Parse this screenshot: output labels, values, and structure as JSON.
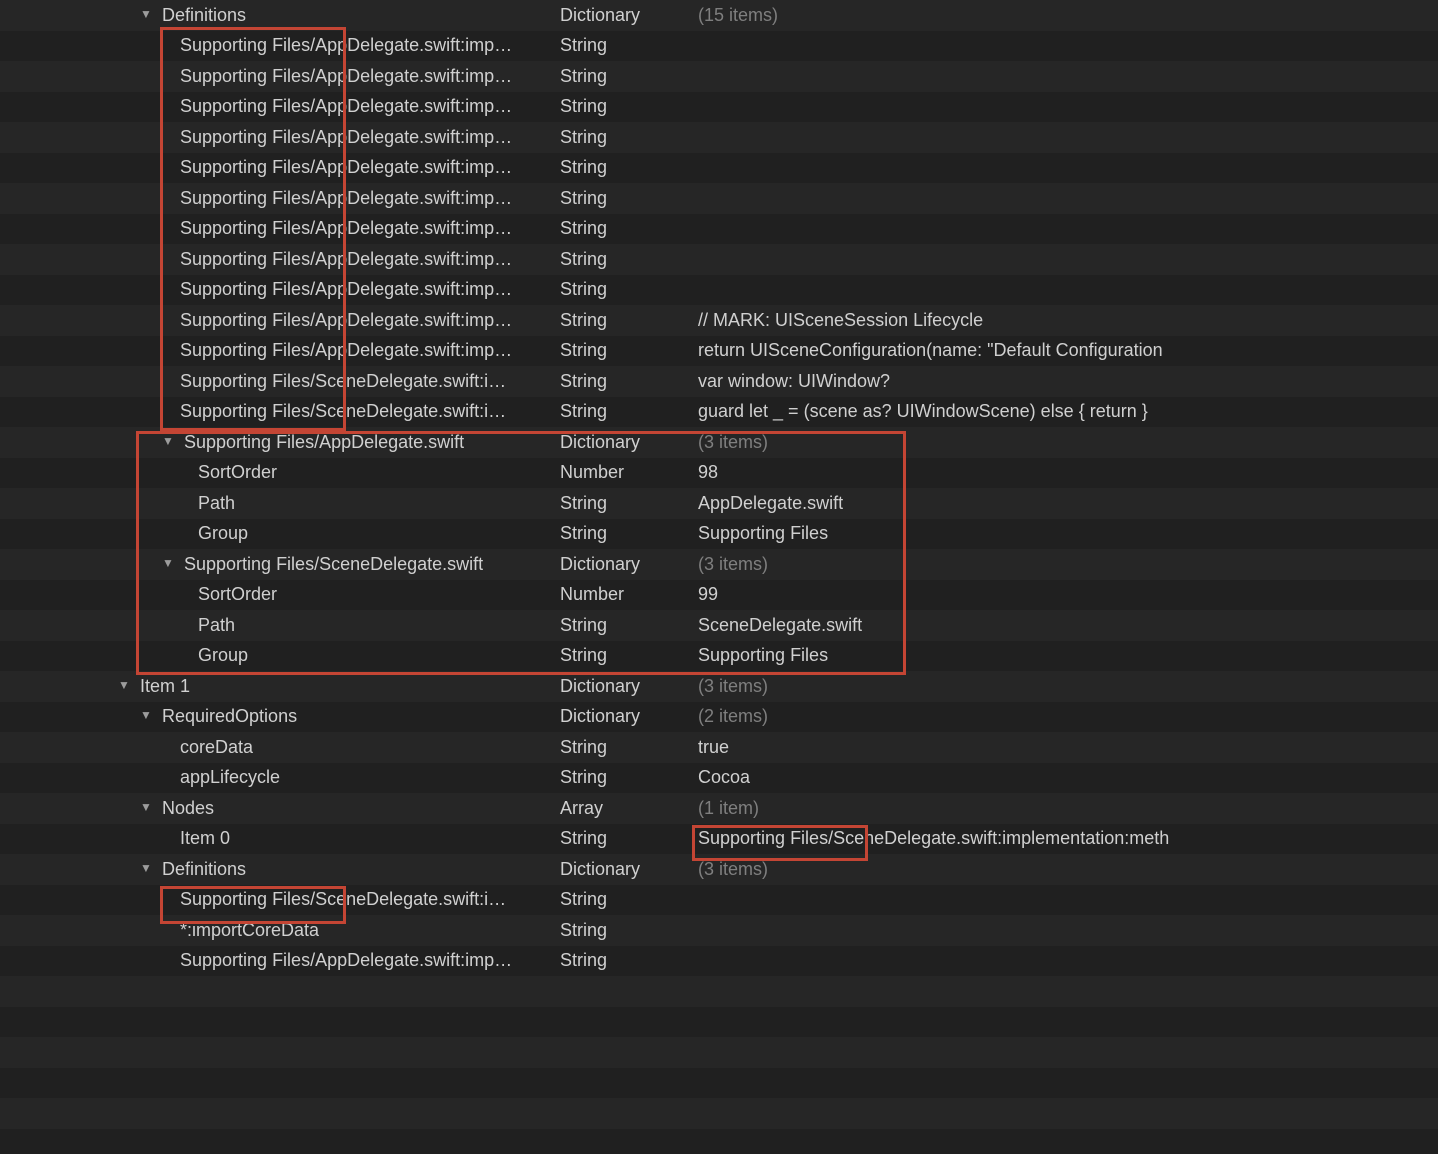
{
  "rows": [
    {
      "indent": 1,
      "expand": true,
      "key": "Definitions",
      "type": "Dictionary",
      "value": "(15 items)",
      "dim": true
    },
    {
      "indent": 3,
      "expand": false,
      "key": "Supporting Files/AppDelegate.swift:imp…",
      "type": "String",
      "value": ""
    },
    {
      "indent": 3,
      "expand": false,
      "key": "Supporting Files/AppDelegate.swift:imp…",
      "type": "String",
      "value": ""
    },
    {
      "indent": 3,
      "expand": false,
      "key": "Supporting Files/AppDelegate.swift:imp…",
      "type": "String",
      "value": ""
    },
    {
      "indent": 3,
      "expand": false,
      "key": "Supporting Files/AppDelegate.swift:imp…",
      "type": "String",
      "value": ""
    },
    {
      "indent": 3,
      "expand": false,
      "key": "Supporting Files/AppDelegate.swift:imp…",
      "type": "String",
      "value": ""
    },
    {
      "indent": 3,
      "expand": false,
      "key": "Supporting Files/AppDelegate.swift:imp…",
      "type": "String",
      "value": ""
    },
    {
      "indent": 3,
      "expand": false,
      "key": "Supporting Files/AppDelegate.swift:imp…",
      "type": "String",
      "value": ""
    },
    {
      "indent": 3,
      "expand": false,
      "key": "Supporting Files/AppDelegate.swift:imp…",
      "type": "String",
      "value": ""
    },
    {
      "indent": 3,
      "expand": false,
      "key": "Supporting Files/AppDelegate.swift:imp…",
      "type": "String",
      "value": ""
    },
    {
      "indent": 3,
      "expand": false,
      "key": "Supporting Files/AppDelegate.swift:imp…",
      "type": "String",
      "value": "// MARK: UISceneSession Lifecycle"
    },
    {
      "indent": 3,
      "expand": false,
      "key": "Supporting Files/AppDelegate.swift:imp…",
      "type": "String",
      "value": "return UISceneConfiguration(name: \"Default Configuration"
    },
    {
      "indent": 3,
      "expand": false,
      "key": "Supporting Files/SceneDelegate.swift:i…",
      "type": "String",
      "value": "var window: UIWindow?"
    },
    {
      "indent": 3,
      "expand": false,
      "key": "Supporting Files/SceneDelegate.swift:i…",
      "type": "String",
      "value": "guard let _ = (scene as? UIWindowScene) else { return }"
    },
    {
      "indent": 2,
      "expand": true,
      "key": "Supporting Files/AppDelegate.swift",
      "type": "Dictionary",
      "value": "(3 items)",
      "dim": true
    },
    {
      "indent": 4,
      "expand": false,
      "key": "SortOrder",
      "type": "Number",
      "value": "98"
    },
    {
      "indent": 4,
      "expand": false,
      "key": "Path",
      "type": "String",
      "value": "AppDelegate.swift"
    },
    {
      "indent": 4,
      "expand": false,
      "key": "Group",
      "type": "String",
      "value": "Supporting Files"
    },
    {
      "indent": 2,
      "expand": true,
      "key": "Supporting Files/SceneDelegate.swift",
      "type": "Dictionary",
      "value": "(3 items)",
      "dim": true
    },
    {
      "indent": 4,
      "expand": false,
      "key": "SortOrder",
      "type": "Number",
      "value": "99"
    },
    {
      "indent": 4,
      "expand": false,
      "key": "Path",
      "type": "String",
      "value": "SceneDelegate.swift"
    },
    {
      "indent": 4,
      "expand": false,
      "key": "Group",
      "type": "String",
      "value": "Supporting Files"
    },
    {
      "indent": 0,
      "expand": true,
      "key": "Item 1",
      "type": "Dictionary",
      "value": "(3 items)",
      "dim": true
    },
    {
      "indent": 1,
      "expand": true,
      "key": "RequiredOptions",
      "type": "Dictionary",
      "value": "(2 items)",
      "dim": true
    },
    {
      "indent": 3,
      "expand": false,
      "key": "coreData",
      "type": "String",
      "value": "true"
    },
    {
      "indent": 3,
      "expand": false,
      "key": "appLifecycle",
      "type": "String",
      "value": "Cocoa"
    },
    {
      "indent": 1,
      "expand": true,
      "key": "Nodes",
      "type": "Array",
      "value": "(1 item)",
      "dim": true
    },
    {
      "indent": 3,
      "expand": false,
      "key": "Item 0",
      "type": "String",
      "value": "Supporting Files/SceneDelegate.swift:implementation:meth"
    },
    {
      "indent": 1,
      "expand": true,
      "key": "Definitions",
      "type": "Dictionary",
      "value": "(3 items)",
      "dim": true
    },
    {
      "indent": 3,
      "expand": false,
      "key": "Supporting Files/SceneDelegate.swift:i…",
      "type": "String",
      "value": ""
    },
    {
      "indent": 3,
      "expand": false,
      "key": "*:importCoreData",
      "type": "String",
      "value": ""
    },
    {
      "indent": 3,
      "expand": false,
      "key": "Supporting Files/AppDelegate.swift:imp…",
      "type": "String",
      "value": ""
    }
  ]
}
